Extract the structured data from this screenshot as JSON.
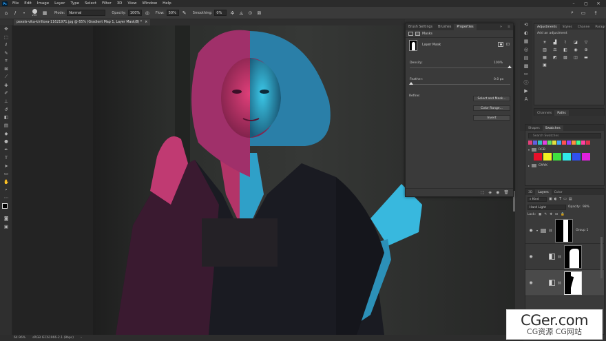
{
  "menu": {
    "logo": "Ps",
    "items": [
      "File",
      "Edit",
      "Image",
      "Layer",
      "Type",
      "Select",
      "Filter",
      "3D",
      "View",
      "Window",
      "Help"
    ]
  },
  "options": {
    "brush_size": "250",
    "mode_label": "Mode:",
    "mode_value": "Normal",
    "opacity_label": "Opacity:",
    "opacity_value": "100%",
    "flow_label": "Flow:",
    "flow_value": "50%",
    "smoothing_label": "Smoothing:",
    "smoothing_value": "0%"
  },
  "document": {
    "tab_title": "pexels-vika-kirillova-11621971.jpg @ 65% (Gradient Map 1, Layer Mask/8) *",
    "tab_close": "×"
  },
  "status": {
    "zoom": "64.96%",
    "profile": "sRGB IEC61966-2.1 (8bpc)"
  },
  "properties_panel": {
    "tabs": [
      "Brush Settings",
      "Brushes",
      "Properties"
    ],
    "active_tab": "Properties",
    "masks_label": "Masks",
    "layer_mask_label": "Layer Mask",
    "density_label": "Density:",
    "density_value": "100%",
    "feather_label": "Feather:",
    "feather_value": "0.0 px",
    "refine_label": "Refine:",
    "buttons": {
      "select_mask": "Select and Mask...",
      "color_range": "Color Range...",
      "invert": "Invert"
    }
  },
  "adjustments_panel": {
    "tabs": [
      "Adjustments",
      "Styles",
      "Channe",
      "Paragr"
    ],
    "subtitle": "Add an adjustment"
  },
  "channels_panel": {
    "tabs": [
      "Channels",
      "Paths"
    ]
  },
  "swatches_panel": {
    "tabs": [
      "Shapes",
      "Swatches"
    ],
    "search_placeholder": "Search Swatches",
    "recent_colors": [
      "#e0407a",
      "#6060e0",
      "#30c0c0",
      "#e040e0",
      "#60e060",
      "#e0e040",
      "#40a0ff",
      "#ff5050",
      "#9040ff",
      "#ff9040",
      "#40ff90",
      "#ff40a0",
      "#e0304a"
    ],
    "groups": [
      {
        "name": "RGB",
        "colors": [
          "#e8102a",
          "#f0f020",
          "#40e040",
          "#30e8e8",
          "#3050f0",
          "#e020e0"
        ]
      },
      {
        "name": "CMYK"
      }
    ]
  },
  "layers_panel": {
    "tabs": [
      "3D",
      "Layers",
      "Color"
    ],
    "kind_label": "Kind",
    "blend_mode": "Hard Light",
    "opacity_label": "Opacity:",
    "opacity_value": "98%",
    "lock_label": "Lock:",
    "layers": [
      {
        "name": "Group 1"
      },
      {
        "name": ""
      },
      {
        "name": ""
      }
    ]
  },
  "watermark": {
    "line1": "CGer.com",
    "line2": "CG资源 CG网站"
  }
}
